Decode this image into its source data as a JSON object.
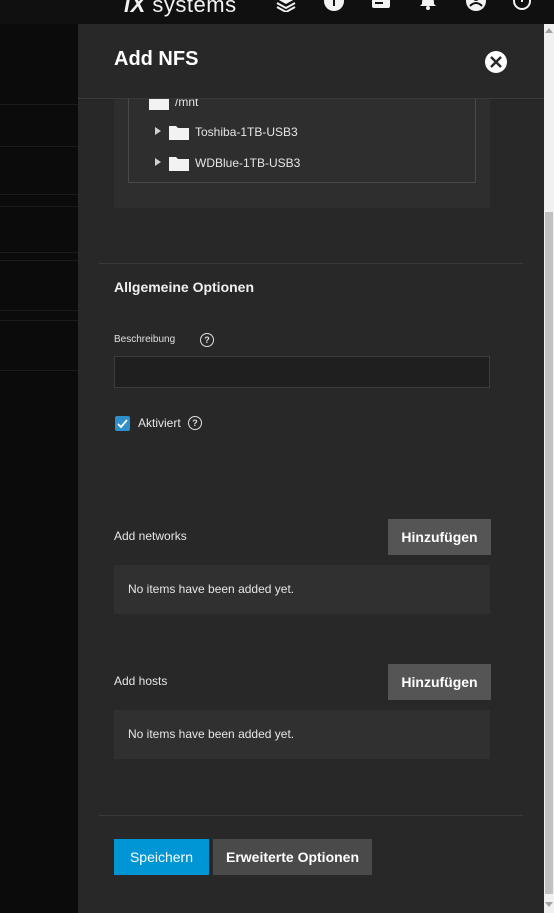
{
  "header": {
    "brand_ix": "iX",
    "brand_word": "systems",
    "icons": [
      "truecommand-icon",
      "info-icon",
      "tasks-icon",
      "bell-icon",
      "account-icon",
      "power-icon"
    ]
  },
  "panel": {
    "title": "Add NFS",
    "tree": {
      "root": "/mnt",
      "children": [
        "Toshiba-1TB-USB3",
        "WDBlue-1TB-USB3"
      ]
    },
    "general": {
      "title": "Allgemeine Optionen",
      "description_label": "Beschreibung",
      "description_value": "",
      "enabled_label": "Aktiviert",
      "enabled": true
    },
    "networks": {
      "label": "Add networks",
      "add_label": "Hinzufügen",
      "empty_text": "No items have been added yet."
    },
    "hosts": {
      "label": "Add hosts",
      "add_label": "Hinzufügen",
      "empty_text": "No items have been added yet."
    },
    "actions": {
      "save_label": "Speichern",
      "advanced_label": "Erweiterte Optionen"
    }
  },
  "colors": {
    "accent": "#0095d5",
    "checkbox": "#2e8fc9",
    "panel_bg": "#282828"
  }
}
